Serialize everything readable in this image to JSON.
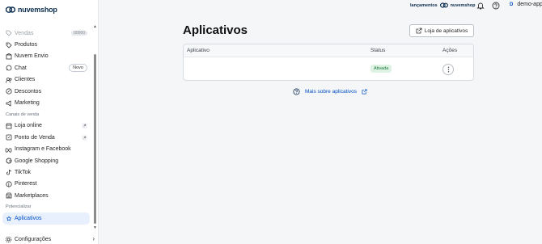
{
  "brand": {
    "name": "nuvemshop"
  },
  "topbar": {
    "launch_label": "lançamentos",
    "launch_brand": "nuvemshop",
    "user_initial": "D",
    "user_name": "demo-app"
  },
  "sidebar": {
    "items": [
      {
        "label": "Vendas",
        "icon": "tag-icon",
        "badge": "00000"
      },
      {
        "label": "Produtos",
        "icon": "price-tag-icon"
      },
      {
        "label": "Nuvem Envio",
        "icon": "box-icon"
      },
      {
        "label": "Chat",
        "icon": "chat-icon",
        "badge": "Novo"
      },
      {
        "label": "Clientes",
        "icon": "users-icon"
      },
      {
        "label": "Descontos",
        "icon": "discount-icon"
      },
      {
        "label": "Marketing",
        "icon": "megaphone-icon"
      }
    ],
    "channels_title": "Canais de venda",
    "channels": [
      {
        "label": "Loja online",
        "icon": "store-icon"
      },
      {
        "label": "Ponto de Venda",
        "icon": "pos-icon"
      },
      {
        "label": "Instagram e Facebook",
        "icon": "meta-icon"
      },
      {
        "label": "Google Shopping",
        "icon": "google-icon"
      },
      {
        "label": "TikTok",
        "icon": "tiktok-icon"
      },
      {
        "label": "Pinterest",
        "icon": "pinterest-icon"
      },
      {
        "label": "Marketplaces",
        "icon": "marketplace-icon"
      }
    ],
    "boost_title": "Potencializar",
    "boost_items": [
      {
        "label": "Aplicativos",
        "icon": "apps-icon"
      }
    ],
    "settings_label": "Configurações"
  },
  "main": {
    "title": "Aplicativos",
    "store_button": "Loja de aplicativos",
    "table": {
      "headers": [
        "Aplicativo",
        "Status",
        "Ações"
      ],
      "rows": [
        {
          "app": "",
          "status": "Ativada"
        }
      ]
    },
    "more_link": "Mais sobre aplicativos"
  },
  "colors": {
    "accent": "#0050c3",
    "status_active_bg": "#dff3e4",
    "status_active_fg": "#1b7a3a"
  }
}
